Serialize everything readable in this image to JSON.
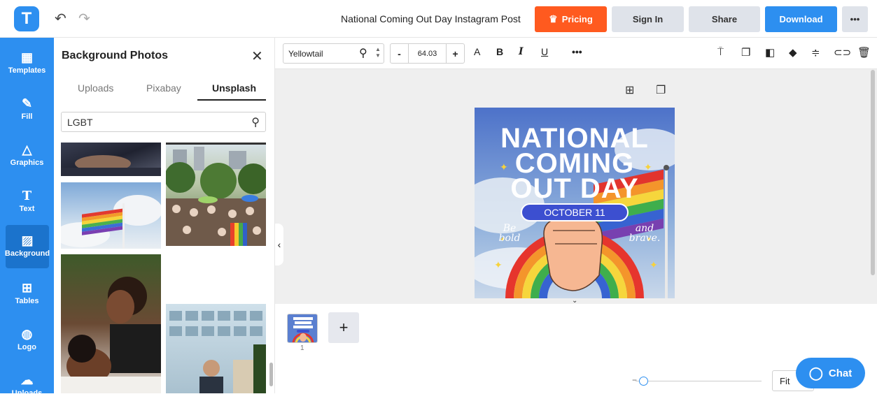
{
  "topbar": {
    "logo": "T",
    "doc_title": "National Coming Out Day Instagram Post",
    "pricing": "Pricing",
    "sign_in": "Sign In",
    "share": "Share",
    "download": "Download",
    "more": "•••"
  },
  "nav": [
    "Templates",
    "Fill",
    "Graphics",
    "Text",
    "Background",
    "Tables",
    "Logo",
    "Uploads"
  ],
  "panel": {
    "title": "Background Photos",
    "tabs": [
      "Uploads",
      "Pixabay",
      "Unsplash"
    ],
    "active_tab": "Unsplash",
    "search_value": "LGBT"
  },
  "format": {
    "font": "Yellowtail",
    "size": "64.03",
    "minus": "-",
    "plus": "+"
  },
  "poster": {
    "line1": "NATIONAL",
    "line2": "COMING",
    "line3": "OUT DAY",
    "date": "OCTOBER 11",
    "left_script": "Be bold",
    "right_script": "and brave."
  },
  "pages": {
    "page_number": "1"
  },
  "zoom": {
    "fit": "Fit"
  },
  "chat": {
    "label": "Chat"
  },
  "colors": {
    "accent": "#2d8ff0",
    "pricing": "#ff5a1f",
    "nav_active": "#1b73cc"
  }
}
